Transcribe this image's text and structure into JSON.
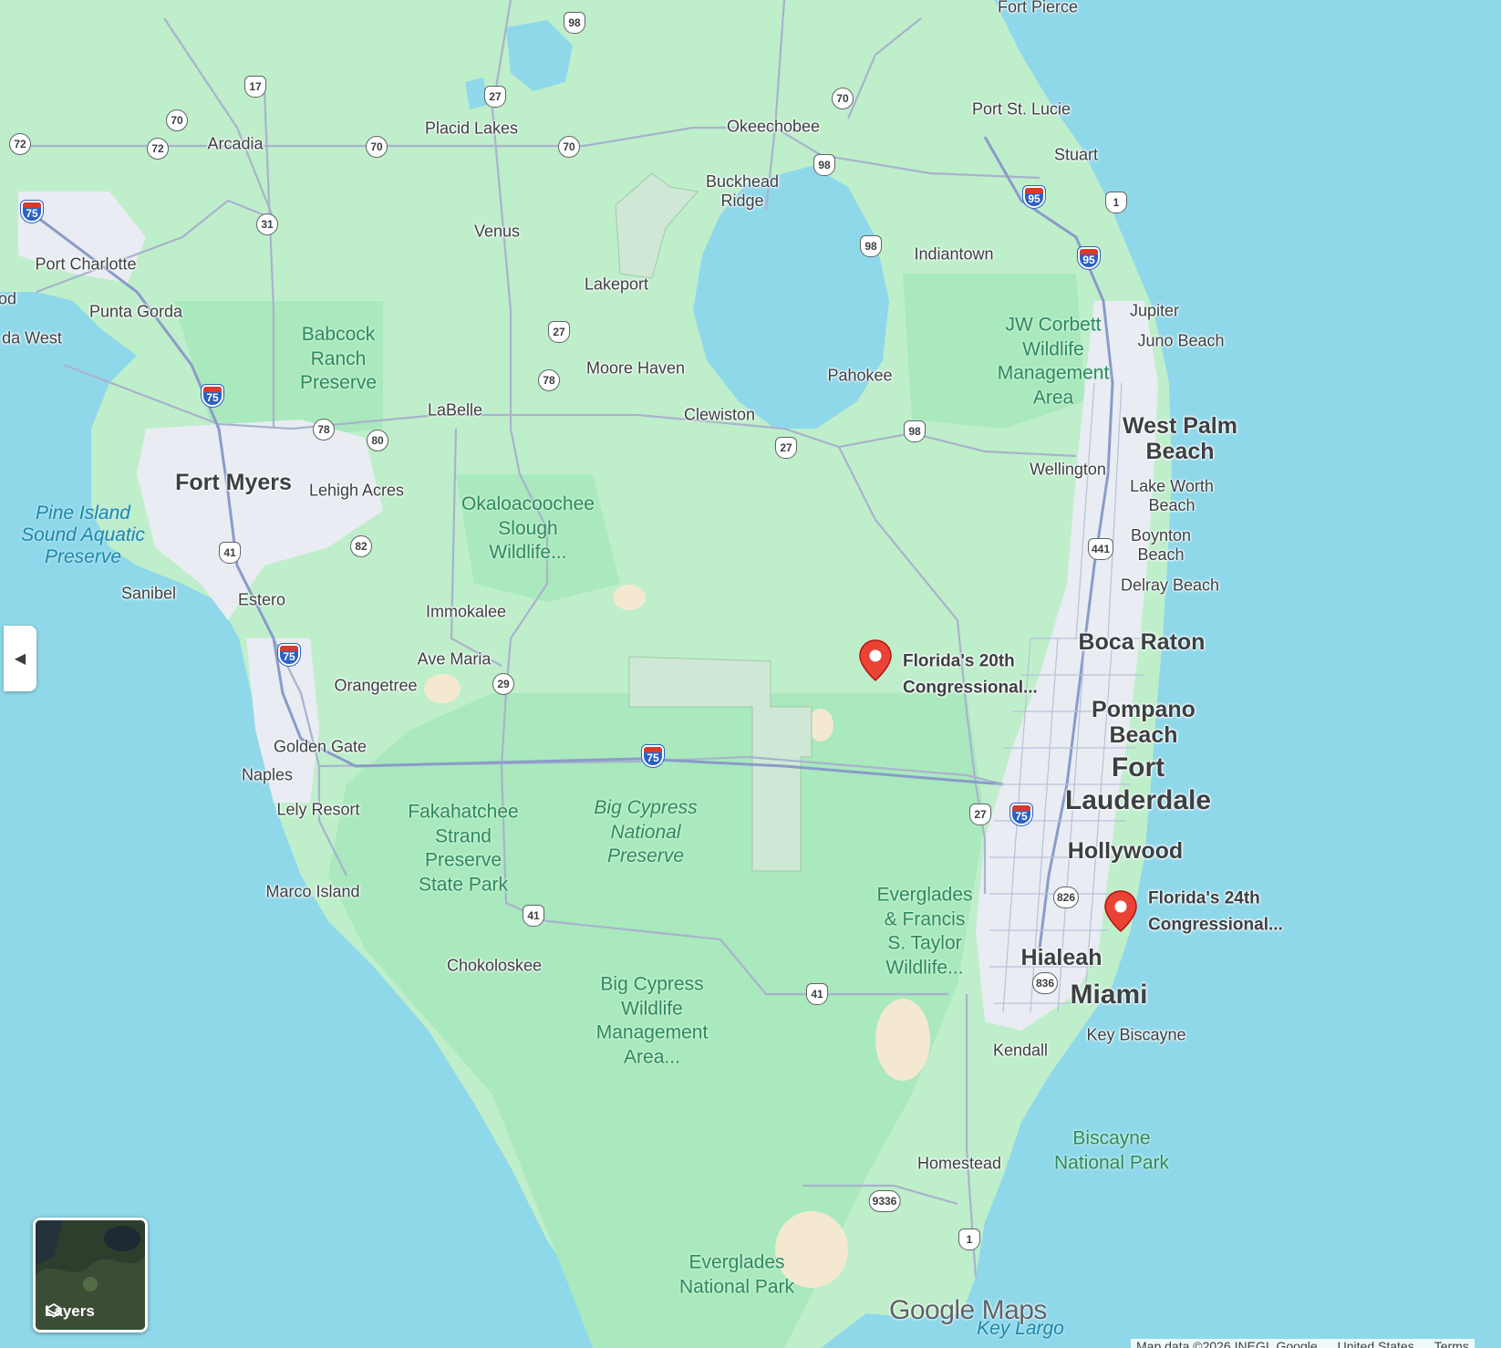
{
  "colors": {
    "water": "#8fd8ea",
    "land": "#bfeecb",
    "park": "#a9e9bd",
    "urban": "#e9ecf3",
    "road": "#9aa8c6",
    "pin": "#ea4335",
    "interstate": "#2a61c4"
  },
  "map": {
    "watermark": "Google Maps",
    "towns": [
      {
        "id": "fort-pierce",
        "text": "Fort Pierce"
      },
      {
        "id": "port-st-lucie",
        "text": "Port St. Lucie"
      },
      {
        "id": "stuart",
        "text": "Stuart"
      },
      {
        "id": "placid-lakes",
        "text": "Placid Lakes"
      },
      {
        "id": "okeechobee",
        "text": "Okeechobee"
      },
      {
        "id": "arcadia",
        "text": "Arcadia"
      },
      {
        "id": "buckhead-ridge",
        "text": "Buckhead\nRidge"
      },
      {
        "id": "venus",
        "text": "Venus"
      },
      {
        "id": "indiantown",
        "text": "Indiantown"
      },
      {
        "id": "port-charlotte",
        "text": "Port Charlotte"
      },
      {
        "id": "od",
        "text": "od"
      },
      {
        "id": "lakeport",
        "text": "Lakeport"
      },
      {
        "id": "jupiter",
        "text": "Jupiter"
      },
      {
        "id": "punta-gorda",
        "text": "Punta Gorda"
      },
      {
        "id": "da-west",
        "text": "da West"
      },
      {
        "id": "juno-beach",
        "text": "Juno Beach"
      },
      {
        "id": "moore-haven",
        "text": "Moore Haven"
      },
      {
        "id": "pahokee",
        "text": "Pahokee"
      },
      {
        "id": "labelle",
        "text": "LaBelle"
      },
      {
        "id": "clewiston",
        "text": "Clewiston"
      },
      {
        "id": "wellington",
        "text": "Wellington"
      },
      {
        "id": "lehigh-acres",
        "text": "Lehigh Acres"
      },
      {
        "id": "lake-worth-beach",
        "text": "Lake Worth\nBeach"
      },
      {
        "id": "boynton-beach",
        "text": "Boynton\nBeach"
      },
      {
        "id": "delray-beach",
        "text": "Delray Beach"
      },
      {
        "id": "sanibel",
        "text": "Sanibel"
      },
      {
        "id": "estero",
        "text": "Estero"
      },
      {
        "id": "immokalee",
        "text": "Immokalee"
      },
      {
        "id": "ave-maria",
        "text": "Ave Maria"
      },
      {
        "id": "orangetree",
        "text": "Orangetree"
      },
      {
        "id": "golden-gate",
        "text": "Golden Gate"
      },
      {
        "id": "naples",
        "text": "Naples"
      },
      {
        "id": "lely-resort",
        "text": "Lely Resort"
      },
      {
        "id": "marco-island",
        "text": "Marco Island"
      },
      {
        "id": "chokoloskee",
        "text": "Chokoloskee"
      },
      {
        "id": "key-biscayne",
        "text": "Key Biscayne"
      },
      {
        "id": "kendall",
        "text": "Kendall"
      },
      {
        "id": "homestead",
        "text": "Homestead"
      }
    ],
    "cities": [
      {
        "id": "west-palm-beach",
        "text": "West Palm\nBeach"
      },
      {
        "id": "fort-myers",
        "text": "Fort Myers"
      },
      {
        "id": "boca-raton",
        "text": "Boca Raton"
      },
      {
        "id": "pompano-beach",
        "text": "Pompano\nBeach"
      },
      {
        "id": "hollywood",
        "text": "Hollywood"
      },
      {
        "id": "hialeah",
        "text": "Hialeah"
      }
    ],
    "metros": [
      {
        "id": "fort-lauderdale",
        "text": "Fort\nLauderdale"
      },
      {
        "id": "miami",
        "text": "Miami"
      }
    ],
    "parks": [
      {
        "id": "babcock-ranch",
        "text": "Babcock\nRanch\nPreserve"
      },
      {
        "id": "jw-corbett",
        "text": "JW Corbett\nWildlife\nManagement\nArea"
      },
      {
        "id": "okaloacoochee",
        "text": "Okaloacoochee\nSlough\nWildlife..."
      },
      {
        "id": "fakahatchee",
        "text": "Fakahatchee\nStrand\nPreserve\nState Park"
      },
      {
        "id": "big-cypress-np",
        "text": "Big Cypress\nNational\nPreserve"
      },
      {
        "id": "everglades-taylor",
        "text": "Everglades\n& Francis\nS. Taylor\nWildlife..."
      },
      {
        "id": "big-cypress-wma",
        "text": "Big Cypress\nWildlife\nManagement\nArea..."
      },
      {
        "id": "biscayne-np",
        "text": "Biscayne\nNational Park"
      },
      {
        "id": "everglades-np",
        "text": "Everglades\nNational Park"
      }
    ],
    "water_labels": [
      {
        "id": "pine-island-sound",
        "text": "Pine Island\nSound Aquatic\nPreserve"
      },
      {
        "id": "key-largo",
        "text": "Key Largo"
      }
    ],
    "pins": [
      {
        "id": "fl-20",
        "text": "Florida's 20th\nCongressional..."
      },
      {
        "id": "fl-24",
        "text": "Florida's 24th\nCongressional..."
      }
    ],
    "shields": [
      {
        "id": "s98a",
        "num": "98",
        "type": "us"
      },
      {
        "id": "s27a",
        "num": "27",
        "type": "us"
      },
      {
        "id": "s17",
        "num": "17",
        "type": "us"
      },
      {
        "id": "s70a",
        "num": "70",
        "type": "state"
      },
      {
        "id": "s70b",
        "num": "70",
        "type": "state"
      },
      {
        "id": "s72a",
        "num": "72",
        "type": "state"
      },
      {
        "id": "s72b",
        "num": "72",
        "type": "state"
      },
      {
        "id": "s70c",
        "num": "70",
        "type": "state"
      },
      {
        "id": "s70d",
        "num": "70",
        "type": "state"
      },
      {
        "id": "s98b",
        "num": "98",
        "type": "us"
      },
      {
        "id": "s95a",
        "num": "95",
        "type": "i"
      },
      {
        "id": "s1a",
        "num": "1",
        "type": "us"
      },
      {
        "id": "s75a",
        "num": "75",
        "type": "i"
      },
      {
        "id": "s31",
        "num": "31",
        "type": "state"
      },
      {
        "id": "s98c",
        "num": "98",
        "type": "us"
      },
      {
        "id": "s95b",
        "num": "95",
        "type": "i"
      },
      {
        "id": "s27b",
        "num": "27",
        "type": "us"
      },
      {
        "id": "s78a",
        "num": "78",
        "type": "state"
      },
      {
        "id": "s75b",
        "num": "75",
        "type": "i"
      },
      {
        "id": "s78b",
        "num": "78",
        "type": "state"
      },
      {
        "id": "s80",
        "num": "80",
        "type": "state"
      },
      {
        "id": "s27c",
        "num": "27",
        "type": "us"
      },
      {
        "id": "s98d",
        "num": "98",
        "type": "us"
      },
      {
        "id": "s441",
        "num": "441",
        "type": "us"
      },
      {
        "id": "s41a",
        "num": "41",
        "type": "us"
      },
      {
        "id": "s82",
        "num": "82",
        "type": "state"
      },
      {
        "id": "s75c",
        "num": "75",
        "type": "i"
      },
      {
        "id": "s29",
        "num": "29",
        "type": "state"
      },
      {
        "id": "s75d",
        "num": "75",
        "type": "i"
      },
      {
        "id": "s27d",
        "num": "27",
        "type": "us"
      },
      {
        "id": "s75e",
        "num": "75",
        "type": "i"
      },
      {
        "id": "s826",
        "num": "826",
        "type": "state"
      },
      {
        "id": "s41b",
        "num": "41",
        "type": "us"
      },
      {
        "id": "s836",
        "num": "836",
        "type": "state"
      },
      {
        "id": "s41c",
        "num": "41",
        "type": "us"
      },
      {
        "id": "s9336",
        "num": "9336",
        "type": "state"
      },
      {
        "id": "s1b",
        "num": "1",
        "type": "us"
      }
    ]
  },
  "controls": {
    "collapse_icon": "chevron-left-icon",
    "collapse_glyph": "◀",
    "layers_label": "Layers",
    "layers_icon": "layers-icon"
  },
  "footer": {
    "attribution": "Map data ©2026 INEGI, Google",
    "region": "United States",
    "terms": "Terms"
  }
}
